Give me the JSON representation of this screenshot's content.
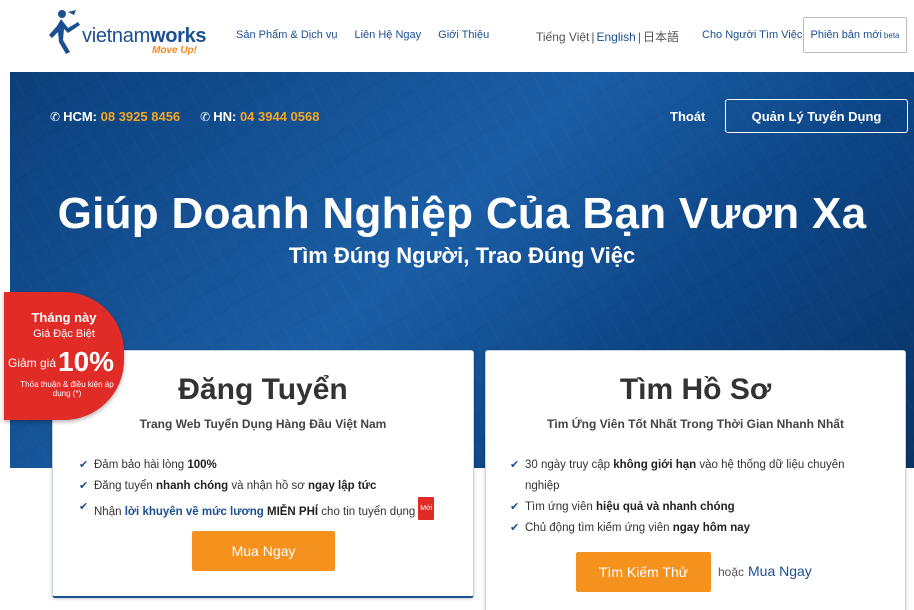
{
  "brand": {
    "name_part1": "vietnam",
    "name_part2": "works",
    "tagline": "Move Up!"
  },
  "nav": {
    "items": [
      "Sản Phẩm & Dịch vụ",
      "Liên Hệ Ngay",
      "Giới Thiệu"
    ],
    "languages": [
      "Tiếng Việt",
      "English",
      "日本語"
    ],
    "for_seeker": "Cho Người Tìm Việc",
    "new_version": "Phiên bản mới",
    "new_version_sup": "beta"
  },
  "hero": {
    "hcm_label": "HCM:",
    "hcm_phone": "08 3925 8456",
    "hn_label": "HN:",
    "hn_phone": "04 3944 0568",
    "logout": "Thoát",
    "manage_button": "Quản Lý Tuyển Dụng",
    "headline": "Giúp Doanh Nghiệp Của Bạn Vươn Xa",
    "subheadline": "Tìm Đúng Người, Trao Đúng Việc"
  },
  "promo": {
    "line1": "Tháng này",
    "line2": "Giá Đặc Biệt",
    "discount_prefix": "Giảm giá",
    "discount_value": "10%",
    "note": "Thỏa thuận & điều kiện áp dụng (*)"
  },
  "card_post": {
    "title": "Đăng Tuyển",
    "subtitle": "Trang Web Tuyển Dụng Hàng Đầu Việt Nam",
    "f1_a": "Đảm bảo hài lòng ",
    "f1_b": "100%",
    "f2_a": "Đăng tuyển ",
    "f2_b": "nhanh chóng",
    "f2_c": " và nhận hồ sơ ",
    "f2_d": "ngay lập tức",
    "f3_a": "Nhận ",
    "f3_b": "lời khuyên về mức lương",
    "f3_c": " MIỄN PHÍ",
    "f3_d": " cho tin tuyển dụng",
    "new_badge": "Mới",
    "button": "Mua Ngay"
  },
  "card_search": {
    "title": "Tìm Hồ Sơ",
    "subtitle": "Tìm Ứng Viên Tốt Nhất Trong Thời Gian Nhanh Nhất",
    "f1_a": "30 ngày truy cập ",
    "f1_b": "không giới hạn",
    "f1_c": " vào hệ thống dữ liệu chuyên nghiệp",
    "f2_a": "Tìm ứng viên ",
    "f2_b": "hiệu quả và nhanh chóng",
    "f3_a": "Chủ động tìm kiếm ứng viên ",
    "f3_b": "ngay hôm nay",
    "button": "Tìm Kiếm Thử",
    "or_text": "hoặc",
    "or_link": "Mua Ngay"
  },
  "colors": {
    "brand_blue": "#1c4f91",
    "accent_orange": "#f5921e",
    "promo_red": "#e02b27",
    "phone_yellow": "#f5a623"
  }
}
